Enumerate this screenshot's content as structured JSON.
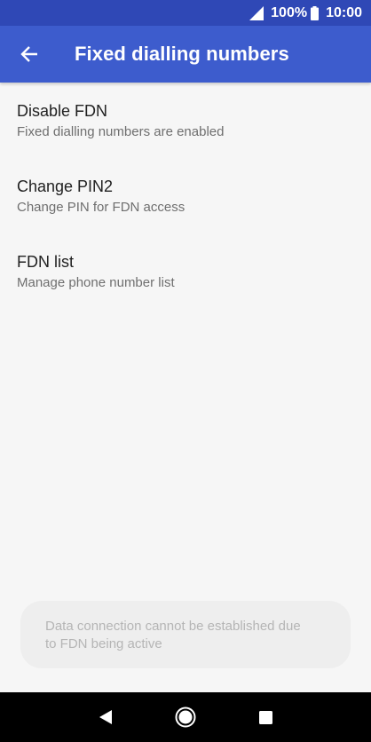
{
  "status_bar": {
    "battery_percent": "100%",
    "time": "10:00",
    "icons": [
      "signal-icon",
      "battery-icon"
    ]
  },
  "app_bar": {
    "title": "Fixed dialling numbers",
    "back_icon": "arrow-left-icon"
  },
  "menu": {
    "items": [
      {
        "title": "Disable FDN",
        "summary": "Fixed dialling numbers are enabled"
      },
      {
        "title": "Change PIN2",
        "summary": "Change PIN for FDN access"
      },
      {
        "title": "FDN list",
        "summary": "Manage phone number list"
      }
    ]
  },
  "toast": {
    "line1": "Data connection cannot be established due",
    "line2": "to FDN being active"
  },
  "nav_bar": {
    "icons": [
      "back-triangle-icon",
      "home-circle-icon",
      "recents-square-icon"
    ]
  },
  "colors": {
    "status_bar": "#2f48b6",
    "app_bar": "#3d5ccd",
    "background": "#f6f6f6",
    "nav_bar": "#000000"
  }
}
